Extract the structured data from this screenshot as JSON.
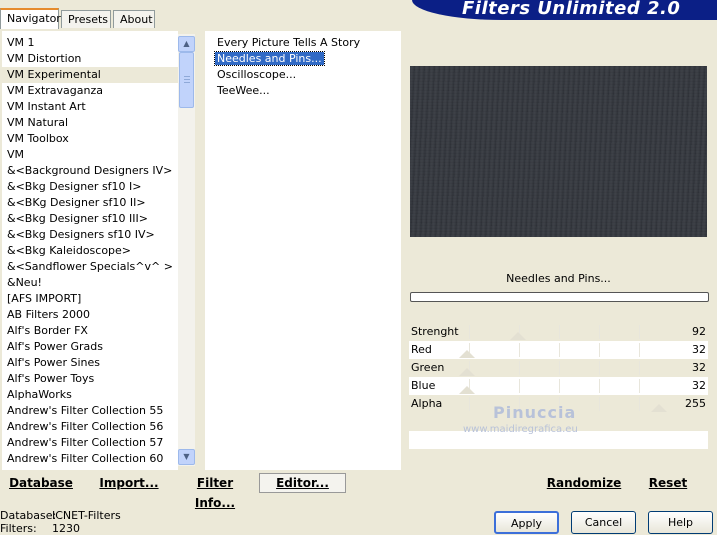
{
  "tabs": [
    {
      "label": "Navigator"
    },
    {
      "label": "Presets"
    },
    {
      "label": "About"
    }
  ],
  "app_title": "Filters Unlimited 2.0",
  "categories": [
    "VM 1",
    "VM Distortion",
    "VM Experimental",
    "VM Extravaganza",
    "VM Instant Art",
    "VM Natural",
    "VM Toolbox",
    "VM",
    "&<Background Designers IV>",
    "&<Bkg Designer sf10 I>",
    "&<BKg Designer sf10 II>",
    "&<Bkg Designer sf10 III>",
    "&<Bkg Designers sf10 IV>",
    "&<Bkg Kaleidoscope>",
    "&<Sandflower Specials^v^ >",
    "&Neu!",
    "[AFS IMPORT]",
    "AB Filters 2000",
    "Alf's Border FX",
    "Alf's Power Grads",
    "Alf's Power Sines",
    "Alf's Power Toys",
    "AlphaWorks",
    "Andrew's Filter Collection 55",
    "Andrew's Filter Collection 56",
    "Andrew's Filter Collection 57",
    "Andrew's Filter Collection 60"
  ],
  "selected_category": "VM Experimental",
  "filters": [
    "Every Picture Tells A Story",
    "Needles and Pins...",
    "Oscilloscope...",
    "TeeWee..."
  ],
  "selected_filter": "Needles and Pins...",
  "filter_name": "Needles and Pins...",
  "params": [
    {
      "label": "Strenght",
      "value": "92",
      "level": 92
    },
    {
      "label": "Red",
      "value": "32",
      "level": 32
    },
    {
      "label": "Green",
      "value": "32",
      "level": 32
    },
    {
      "label": "Blue",
      "value": "32",
      "level": 32
    },
    {
      "label": "Alpha",
      "value": "255",
      "level": 255
    }
  ],
  "watermark": {
    "name": "Pinuccia",
    "url": "www.maidiregrafica.eu"
  },
  "toolbar": {
    "database": "Database",
    "import": "Import...",
    "filter_info": "Filter Info...",
    "editor": "Editor...",
    "randomize": "Randomize",
    "reset": "Reset"
  },
  "status": {
    "database_label": "Database:",
    "database_value": "ICNET-Filters",
    "filters_label": "Filters:",
    "filters_value": "1230"
  },
  "buttons": {
    "apply": "Apply",
    "cancel": "Cancel",
    "help": "Help"
  },
  "colors": {
    "selection": "#316ac5",
    "banner": "#0b1f86",
    "tab_highlight": "#e68b2c"
  }
}
